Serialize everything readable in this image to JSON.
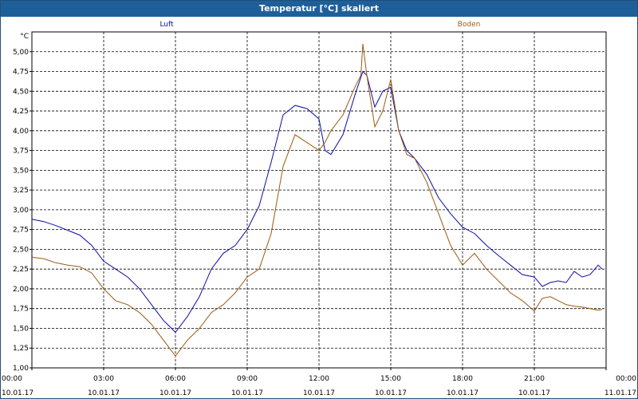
{
  "window": {
    "title": "Temperatur [°C] skaliert"
  },
  "colors": {
    "titlebar": "#1f5f99",
    "Luft": "#0b0ba8",
    "Boden": "#9c5a12",
    "grid": "#000000"
  },
  "chart_data": {
    "type": "line",
    "title": "Temperatur [°C] skaliert",
    "ylabel": "°C",
    "xlabel": "",
    "ylim": [
      1.0,
      5.25
    ],
    "xlim": [
      "10.01.17 00:00",
      "11.01.17 00:00"
    ],
    "yticks": [
      "1,00",
      "1,25",
      "1,50",
      "1,75",
      "2,00",
      "2,25",
      "2,50",
      "2,75",
      "3,00",
      "3,25",
      "3,50",
      "3,75",
      "4,00",
      "4,25",
      "4,50",
      "4,75",
      "5,00"
    ],
    "xticks": [
      {
        "time": "00:00",
        "date": "10.01.17"
      },
      {
        "time": "03:00",
        "date": "10.01.17"
      },
      {
        "time": "06:00",
        "date": "10.01.17"
      },
      {
        "time": "09:00",
        "date": "10.01.17"
      },
      {
        "time": "12:00",
        "date": "10.01.17"
      },
      {
        "time": "15:00",
        "date": "10.01.17"
      },
      {
        "time": "18:00",
        "date": "10.01.17"
      },
      {
        "time": "21:00",
        "date": "10.01.17"
      },
      {
        "time": "00:00",
        "date": "11.01.17"
      }
    ],
    "grid": true,
    "legend": [
      "Luft",
      "Boden"
    ],
    "series": [
      {
        "name": "Luft",
        "x": [
          "00:00",
          "00:30",
          "01:00",
          "01:30",
          "02:00",
          "02:30",
          "03:00",
          "03:30",
          "04:00",
          "04:30",
          "05:00",
          "05:30",
          "06:00",
          "06:30",
          "07:00",
          "07:30",
          "08:00",
          "08:30",
          "09:00",
          "09:30",
          "10:00",
          "10:30",
          "11:00",
          "11:30",
          "12:00",
          "12:15",
          "12:30",
          "13:00",
          "13:30",
          "13:50",
          "14:00",
          "14:20",
          "14:40",
          "15:00",
          "15:20",
          "15:40",
          "16:00",
          "16:30",
          "17:00",
          "17:30",
          "18:00",
          "18:30",
          "19:00",
          "19:30",
          "20:00",
          "20:30",
          "21:00",
          "21:20",
          "21:40",
          "22:00",
          "22:20",
          "22:40",
          "23:00",
          "23:20",
          "23:40",
          "23:50"
        ],
        "y": [
          2.88,
          2.85,
          2.8,
          2.74,
          2.68,
          2.55,
          2.35,
          2.25,
          2.15,
          2.0,
          1.8,
          1.6,
          1.45,
          1.65,
          1.9,
          2.25,
          2.45,
          2.55,
          2.75,
          3.05,
          3.6,
          4.2,
          4.32,
          4.28,
          4.15,
          3.75,
          3.7,
          3.95,
          4.45,
          4.75,
          4.7,
          4.3,
          4.5,
          4.55,
          4.0,
          3.75,
          3.65,
          3.45,
          3.15,
          2.95,
          2.78,
          2.7,
          2.55,
          2.42,
          2.3,
          2.18,
          2.15,
          2.03,
          2.08,
          2.1,
          2.08,
          2.22,
          2.15,
          2.18,
          2.3,
          2.25
        ]
      },
      {
        "name": "Boden",
        "x": [
          "00:00",
          "00:30",
          "01:00",
          "01:30",
          "02:00",
          "02:30",
          "03:00",
          "03:30",
          "04:00",
          "04:30",
          "05:00",
          "05:30",
          "06:00",
          "06:30",
          "07:00",
          "07:30",
          "08:00",
          "08:30",
          "09:00",
          "09:30",
          "10:00",
          "10:30",
          "11:00",
          "11:30",
          "12:00",
          "12:15",
          "12:30",
          "13:00",
          "13:30",
          "13:45",
          "13:50",
          "14:00",
          "14:20",
          "14:40",
          "15:00",
          "15:20",
          "15:40",
          "16:00",
          "16:30",
          "17:00",
          "17:30",
          "18:00",
          "18:30",
          "19:00",
          "19:30",
          "20:00",
          "20:30",
          "21:00",
          "21:20",
          "21:40",
          "22:00",
          "22:20",
          "22:40",
          "23:00",
          "23:20",
          "23:40",
          "23:50"
        ],
        "y": [
          2.4,
          2.38,
          2.33,
          2.3,
          2.28,
          2.2,
          2.0,
          1.85,
          1.8,
          1.7,
          1.55,
          1.35,
          1.15,
          1.35,
          1.5,
          1.7,
          1.8,
          1.95,
          2.15,
          2.25,
          2.7,
          3.55,
          3.95,
          3.85,
          3.75,
          3.85,
          4.0,
          4.2,
          4.55,
          4.7,
          5.1,
          4.7,
          4.05,
          4.25,
          4.65,
          4.0,
          3.7,
          3.65,
          3.35,
          2.95,
          2.55,
          2.3,
          2.45,
          2.25,
          2.1,
          1.95,
          1.85,
          1.72,
          1.88,
          1.9,
          1.85,
          1.8,
          1.78,
          1.77,
          1.75,
          1.73,
          1.74
        ]
      }
    ]
  }
}
